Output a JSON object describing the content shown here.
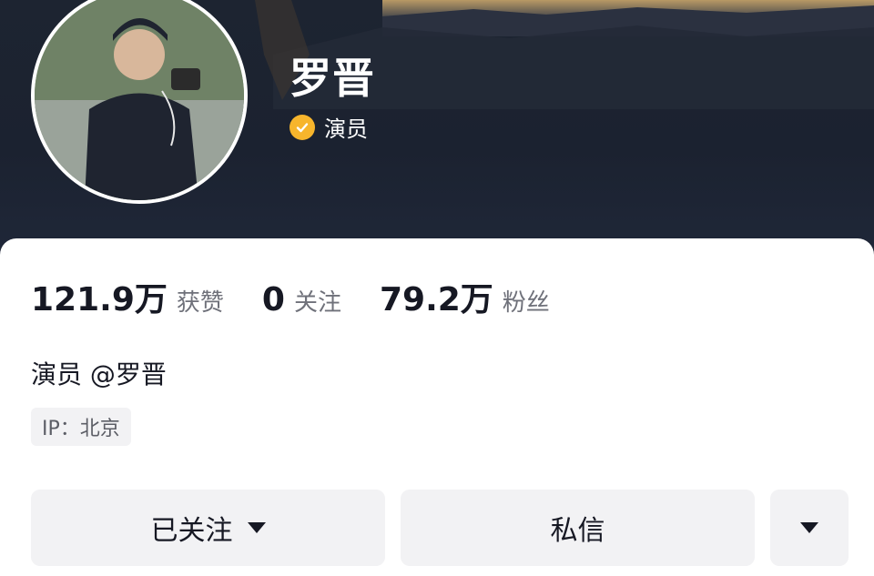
{
  "profile": {
    "name": "罗晋",
    "verify_label": "演员",
    "bio": "演员 @罗晋",
    "ip": "IP：北京"
  },
  "stats": [
    {
      "value": "121.9万",
      "label": "获赞"
    },
    {
      "value": "0",
      "label": "关注"
    },
    {
      "value": "79.2万",
      "label": "粉丝"
    }
  ],
  "actions": {
    "follow_label": "已关注",
    "message_label": "私信"
  },
  "colors": {
    "verify_badge": "#f7b52c",
    "header_bg": "#1d2431",
    "button_bg": "#f2f2f4"
  }
}
